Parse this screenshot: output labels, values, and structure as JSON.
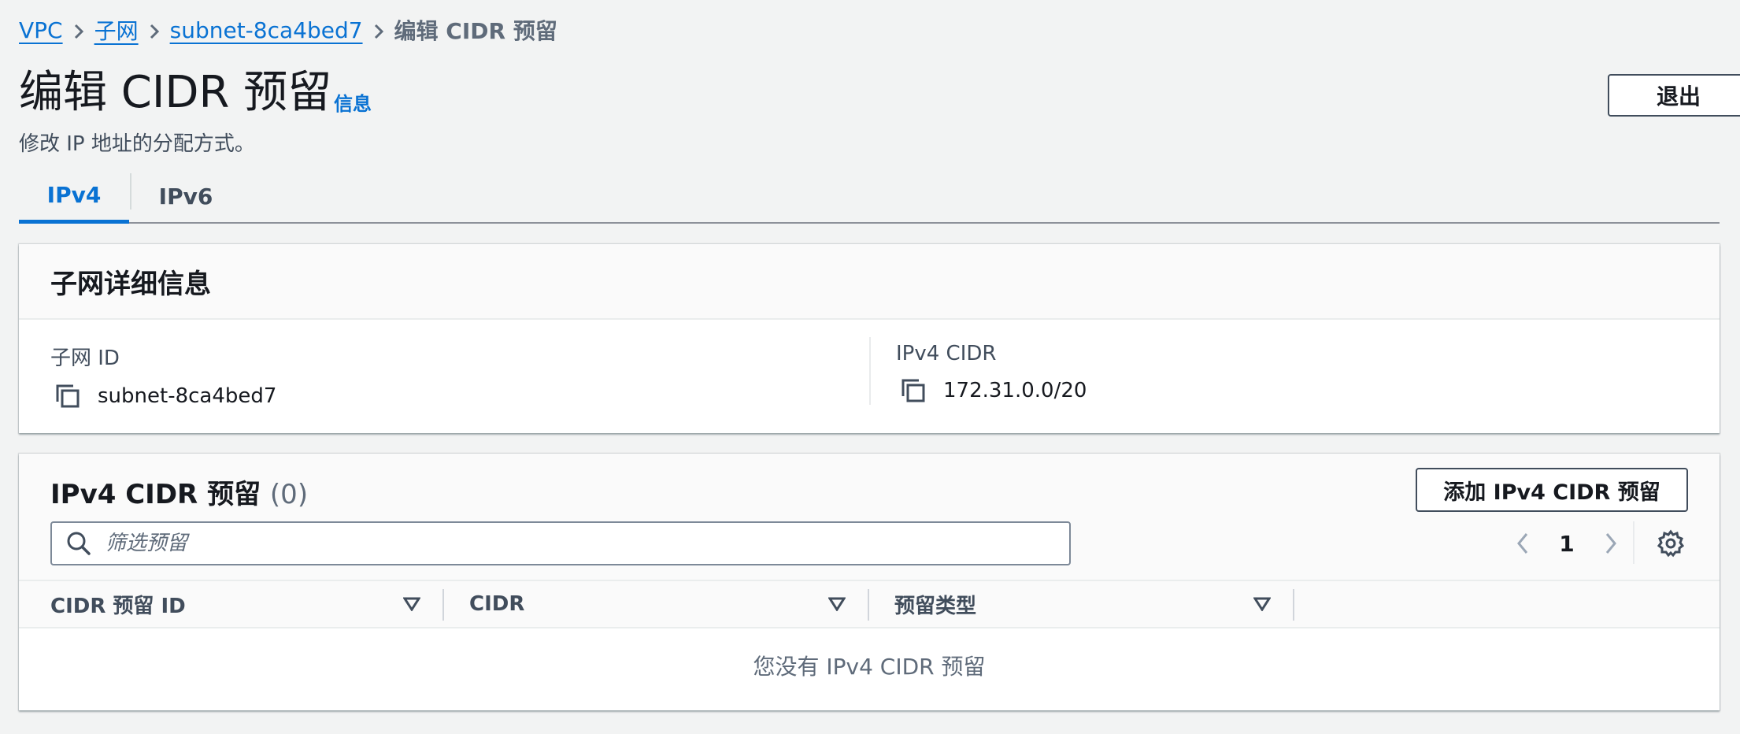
{
  "breadcrumb": {
    "items": [
      "VPC",
      "子网",
      "subnet-8ca4bed7"
    ],
    "current": "编辑 CIDR 预留"
  },
  "header": {
    "title": "编辑 CIDR 预留",
    "info_link": "信息",
    "description": "修改 IP 地址的分配方式。",
    "exit_label": "退出"
  },
  "tabs": [
    {
      "label": "IPv4",
      "selected": true
    },
    {
      "label": "IPv6",
      "selected": false
    }
  ],
  "subnet_details": {
    "title": "子网详细信息",
    "fields": [
      {
        "label": "子网 ID",
        "value": "subnet-8ca4bed7"
      },
      {
        "label": "IPv4 CIDR",
        "value": "172.31.0.0/20"
      }
    ]
  },
  "reservations": {
    "title": "IPv4 CIDR 预留",
    "count": "(0)",
    "add_label": "添加 IPv4 CIDR 预留",
    "search_placeholder": "筛选预留",
    "page": "1",
    "columns": [
      "CIDR 预留 ID",
      "CIDR",
      "预留类型"
    ],
    "empty_message": "您没有 IPv4 CIDR 预留"
  },
  "colors": {
    "link": "#0972d3",
    "text": "#16191f",
    "muted": "#5f6b7a",
    "background": "#f2f3f3"
  },
  "icons": [
    "chevron-right-icon",
    "copy-icon",
    "search-icon",
    "angle-left-icon",
    "angle-right-icon",
    "settings-icon",
    "sort-caret-icon"
  ]
}
